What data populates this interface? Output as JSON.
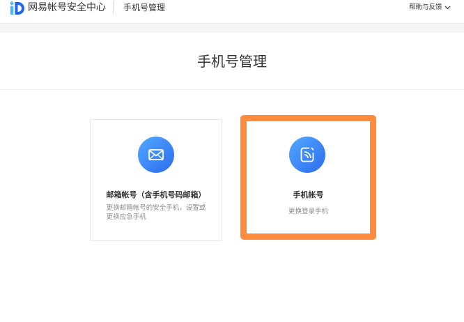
{
  "header": {
    "logo_icon": "id-logo-icon",
    "logo_text": "网易帐号安全中心",
    "section_title": "手机号管理",
    "help_label": "帮助与反馈",
    "help_icon": "chevron-down-icon"
  },
  "main": {
    "title": "手机号管理",
    "cards": [
      {
        "icon": "mail-icon",
        "title": "邮箱帐号（含手机号码邮箱）",
        "desc_lines": [
          "更换邮箱帐号的安全手机，设置或",
          "更换应急手机"
        ],
        "highlighted": false
      },
      {
        "icon": "phone-signal-icon",
        "title": "手机帐号",
        "desc_lines": [
          "更换登录手机"
        ],
        "highlighted": true
      }
    ]
  },
  "colors": {
    "brand_blue": "#2c6cf0",
    "icon_circle_light": "#52a8ff",
    "highlight_orange": "#ff8b3d",
    "text_primary": "#333333",
    "text_secondary": "#8c8c8c",
    "band_gray": "#f5f5f5"
  }
}
